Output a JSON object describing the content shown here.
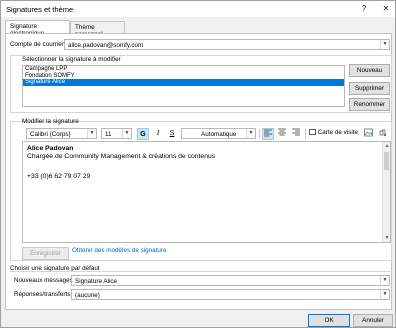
{
  "window": {
    "title": "Signatures et thème",
    "help": "?",
    "close": "✕"
  },
  "tabs": [
    {
      "label": "Signature électronique",
      "active": true
    },
    {
      "label": "Thème personnel",
      "active": false
    }
  ],
  "account": {
    "label": "Compte de courrier",
    "value": "alice.padovan@somfy.com"
  },
  "select_section": {
    "label": "Sélectionner la signature à modifier",
    "items": [
      "Campagne LPP",
      "Fondation SOMFY",
      "Signature Alice"
    ],
    "selected_index": 2
  },
  "side_buttons": {
    "new": "Nouveau",
    "delete": "Supprimer",
    "rename": "Renommer"
  },
  "edit_section": {
    "label": "Modifier la signature"
  },
  "toolbar": {
    "font": "Calibri (Corps)",
    "size": "11",
    "bold": "G",
    "italic": "I",
    "underline": "S",
    "color": "Automatique",
    "business_card": "Carte de visite"
  },
  "signature": {
    "name": "Alice Padovan",
    "role": "Chargée de Community Management & créations de contenus",
    "phone": "+33 (0)6 62 79 07 29"
  },
  "actions": {
    "save": "Enregistrer",
    "templates_link": "Obtenir des modèles de signature"
  },
  "defaults": {
    "label": "Choisir une signature par défaut",
    "new_messages_label": "Nouveaux messages :",
    "new_messages_value": "Signature Alice",
    "replies_label": "Réponses/transferts :",
    "replies_value": "(aucune)"
  },
  "footer": {
    "ok": "OK",
    "cancel": "Annuler"
  },
  "colors": {
    "selection": "#0078d7",
    "link": "#0066cc"
  }
}
